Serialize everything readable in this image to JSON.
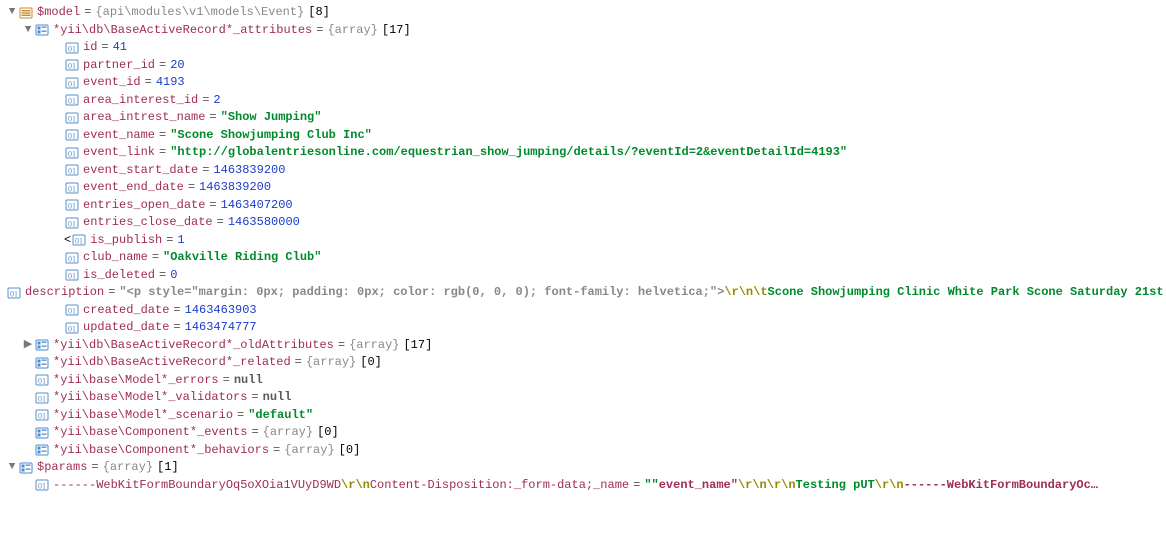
{
  "root": {
    "model_label": "$model",
    "model_type": "{api\\modules\\v1\\models\\Event}",
    "model_count": "[8]",
    "attrs_label": "*yii\\db\\BaseActiveRecord*_attributes",
    "attrs_type": "{array}",
    "attrs_count": "[17]"
  },
  "attrs": {
    "id": {
      "k": "id",
      "v": "41"
    },
    "partner_id": {
      "k": "partner_id",
      "v": "20"
    },
    "event_id": {
      "k": "event_id",
      "v": "4193"
    },
    "area_interest_id": {
      "k": "area_interest_id",
      "v": "2"
    },
    "area_intrest_name": {
      "k": "area_intrest_name",
      "v": "\"Show Jumping\""
    },
    "event_name": {
      "k": "event_name",
      "v": "\"Scone Showjumping Club Inc\""
    },
    "event_link": {
      "k": "event_link",
      "v": "\"http://globalentriesonline.com/equestrian_show_jumping/details/?eventId=2&eventDetailId=4193\""
    },
    "event_start_date": {
      "k": "event_start_date",
      "v": "1463839200"
    },
    "event_end_date": {
      "k": "event_end_date",
      "v": "1463839200"
    },
    "entries_open_date": {
      "k": "entries_open_date",
      "v": "1463407200"
    },
    "entries_close_date": {
      "k": "entries_close_date",
      "v": "1463580000"
    },
    "is_publish": {
      "k": "is_publish",
      "v": "1"
    },
    "club_name": {
      "k": "club_name",
      "v": "\"Oakville Riding Club\""
    },
    "is_deleted": {
      "k": "is_deleted",
      "v": "0"
    },
    "description_k": "description",
    "description_prefix": "\"<p style=\"margin: 0px; padding: 0px; color: rgb(0, 0, 0); font-family: helvetica;\">",
    "description_esc": "\\r\\n\\t",
    "description_body": "Scone Showjumping Clinic White Park Scone Saturday 21st …",
    "created_date": {
      "k": "created_date",
      "v": "1463463903"
    },
    "updated_date": {
      "k": "updated_date",
      "v": "1463474777"
    }
  },
  "tail": {
    "oldAttributes": {
      "k": "*yii\\db\\BaseActiveRecord*_oldAttributes",
      "t": "{array}",
      "c": "[17]"
    },
    "related": {
      "k": "*yii\\db\\BaseActiveRecord*_related",
      "t": "{array}",
      "c": "[0]"
    },
    "errors": {
      "k": "*yii\\base\\Model*_errors"
    },
    "validators": {
      "k": "*yii\\base\\Model*_validators"
    },
    "scenario": {
      "k": "*yii\\base\\Model*_scenario",
      "v": "\"default\""
    },
    "events": {
      "k": "*yii\\base\\Component*_events",
      "t": "{array}",
      "c": "[0]"
    },
    "behaviors": {
      "k": "*yii\\base\\Component*_behaviors",
      "t": "{array}",
      "c": "[0]"
    }
  },
  "params": {
    "label": "$params",
    "type": "{array}",
    "count": "[1]",
    "row_pre": "------WebKitFormBoundaryOq5oXOia1VUyD9WD",
    "row_esc1": "\\r\\n",
    "row_mid": "Content-Disposition:_form-data;_name",
    "row_eq_q": "\"\"",
    "row_val_name": "event_name\"",
    "row_esc2": "\\r\\n\\r\\n",
    "row_body": "Testing pUT",
    "row_esc3": "\\r\\n",
    "row_tail": "------WebKitFormBoundaryOc…"
  },
  "eq": "="
}
